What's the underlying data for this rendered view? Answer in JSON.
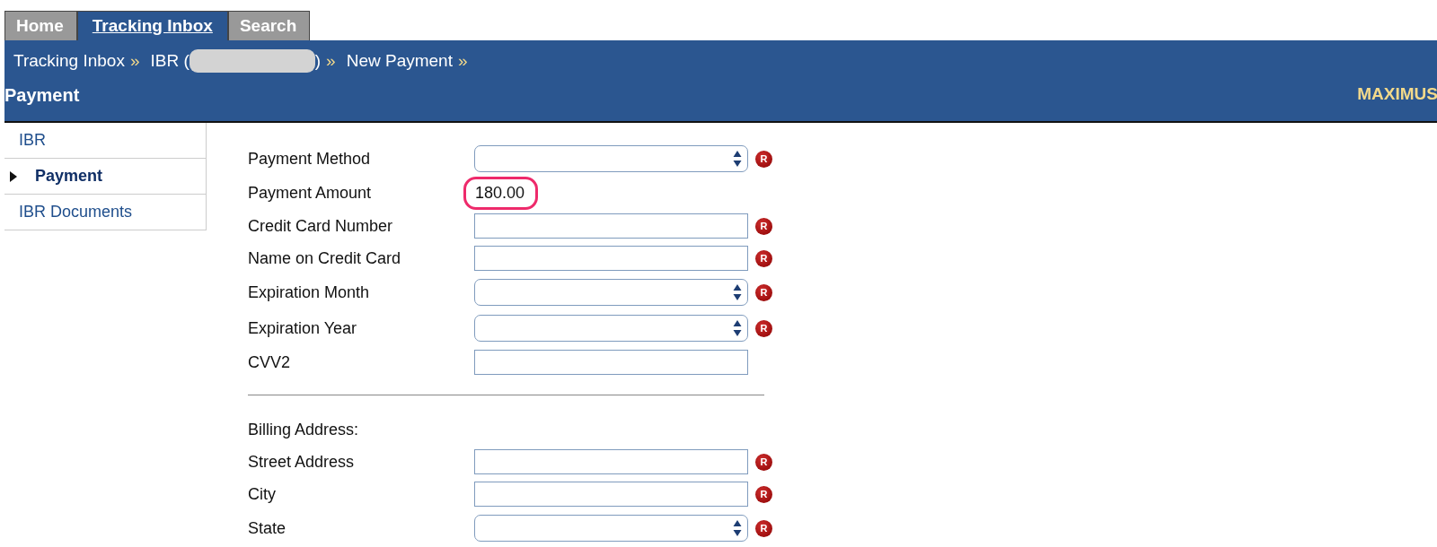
{
  "tabs": [
    {
      "label": "Home",
      "selected": false
    },
    {
      "label": "Tracking Inbox",
      "selected": true
    },
    {
      "label": "Search",
      "selected": false
    }
  ],
  "breadcrumb": [
    {
      "kind": "link",
      "label": "Tracking Inbox"
    },
    {
      "kind": "redacted",
      "label_before": "IBR (",
      "label_after": ")"
    },
    {
      "kind": "link",
      "label": "New Payment"
    }
  ],
  "breadcrumb_separator": "»",
  "page_title": "Payment",
  "brand": "MAXIMUS",
  "sidebar": {
    "items": [
      {
        "label": "IBR",
        "selected": false
      },
      {
        "label": "Payment",
        "selected": true
      },
      {
        "label": "IBR Documents",
        "selected": false
      }
    ]
  },
  "form": {
    "rows": [
      {
        "kind": "select",
        "label": "Payment Method",
        "required_mark": "R"
      },
      {
        "kind": "value",
        "label": "Payment Amount",
        "value": "180.00",
        "highlighted": true
      },
      {
        "kind": "input",
        "label": "Credit Card Number",
        "required_mark": "R"
      },
      {
        "kind": "input",
        "label": "Name on Credit Card",
        "required_mark": "R"
      },
      {
        "kind": "select",
        "label": "Expiration Month",
        "required_mark": "R"
      },
      {
        "kind": "select",
        "label": "Expiration Year",
        "required_mark": "R"
      },
      {
        "kind": "input",
        "label": "CVV2"
      },
      {
        "kind": "divider"
      },
      {
        "kind": "heading",
        "label": "Billing Address:"
      },
      {
        "kind": "input",
        "label": "Street Address",
        "required_mark": "R"
      },
      {
        "kind": "input",
        "label": "City",
        "required_mark": "R"
      },
      {
        "kind": "select",
        "label": "State",
        "required_mark": "R"
      }
    ]
  }
}
